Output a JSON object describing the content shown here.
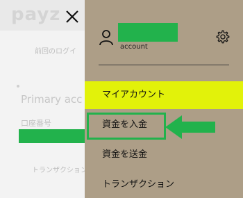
{
  "background": {
    "logo": "payz",
    "last_login": "前回のログイ",
    "primary_account": "Primary acc",
    "account_number_label": "口座番号",
    "transactions": "トランザクション"
  },
  "drawer": {
    "account_label": "account",
    "menu": [
      {
        "label": "マイアカウント"
      },
      {
        "label": "資金を入金"
      },
      {
        "label": "資金を送金"
      },
      {
        "label": "トランザクション"
      }
    ]
  },
  "icons": {
    "close": "close-icon",
    "user": "user-icon",
    "settings": "gear-icon"
  },
  "colors": {
    "drawer_bg": "#ad9e87",
    "active_item": "#e2f20a",
    "highlight_green": "#22b24c"
  }
}
